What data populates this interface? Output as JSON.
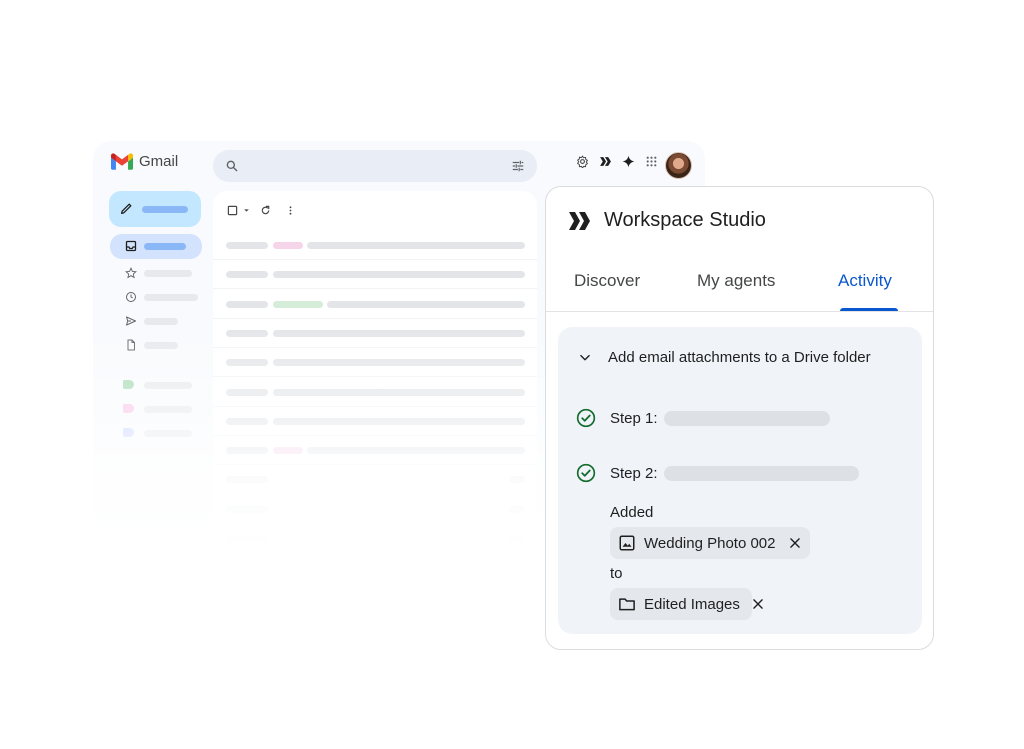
{
  "gmail": {
    "app_name": "Gmail",
    "icons": [
      "gmail-logo",
      "search-icon",
      "tune-icon",
      "settings-icon",
      "workspace-studio-icon",
      "gemini-icon",
      "apps-grid-icon",
      "avatar",
      "pencil-icon",
      "inbox-icon",
      "star-icon",
      "clock-icon",
      "send-icon",
      "file-icon",
      "label-icon",
      "checkbox-icon",
      "refresh-icon",
      "more-vert-icon"
    ],
    "label_colors": [
      "#a8dab5",
      "#f8c4e6",
      "#c9d3ff"
    ]
  },
  "panel": {
    "title": "Workspace Studio",
    "tabs": [
      {
        "label": "Discover",
        "active": false
      },
      {
        "label": "My agents",
        "active": false
      },
      {
        "label": "Activity",
        "active": true
      }
    ],
    "accent_color": "#0b57d0",
    "activity": {
      "title": "Add email attachments to a Drive folder",
      "expanded": true,
      "steps": [
        {
          "label": "Step 1:",
          "status": "complete"
        },
        {
          "label": "Step 2:",
          "status": "complete"
        }
      ],
      "added_label": "Added",
      "file_chip": "Wedding Photo 002",
      "to_label": "to",
      "folder_chip": "Edited Images"
    },
    "success_color": "#146c2e"
  }
}
